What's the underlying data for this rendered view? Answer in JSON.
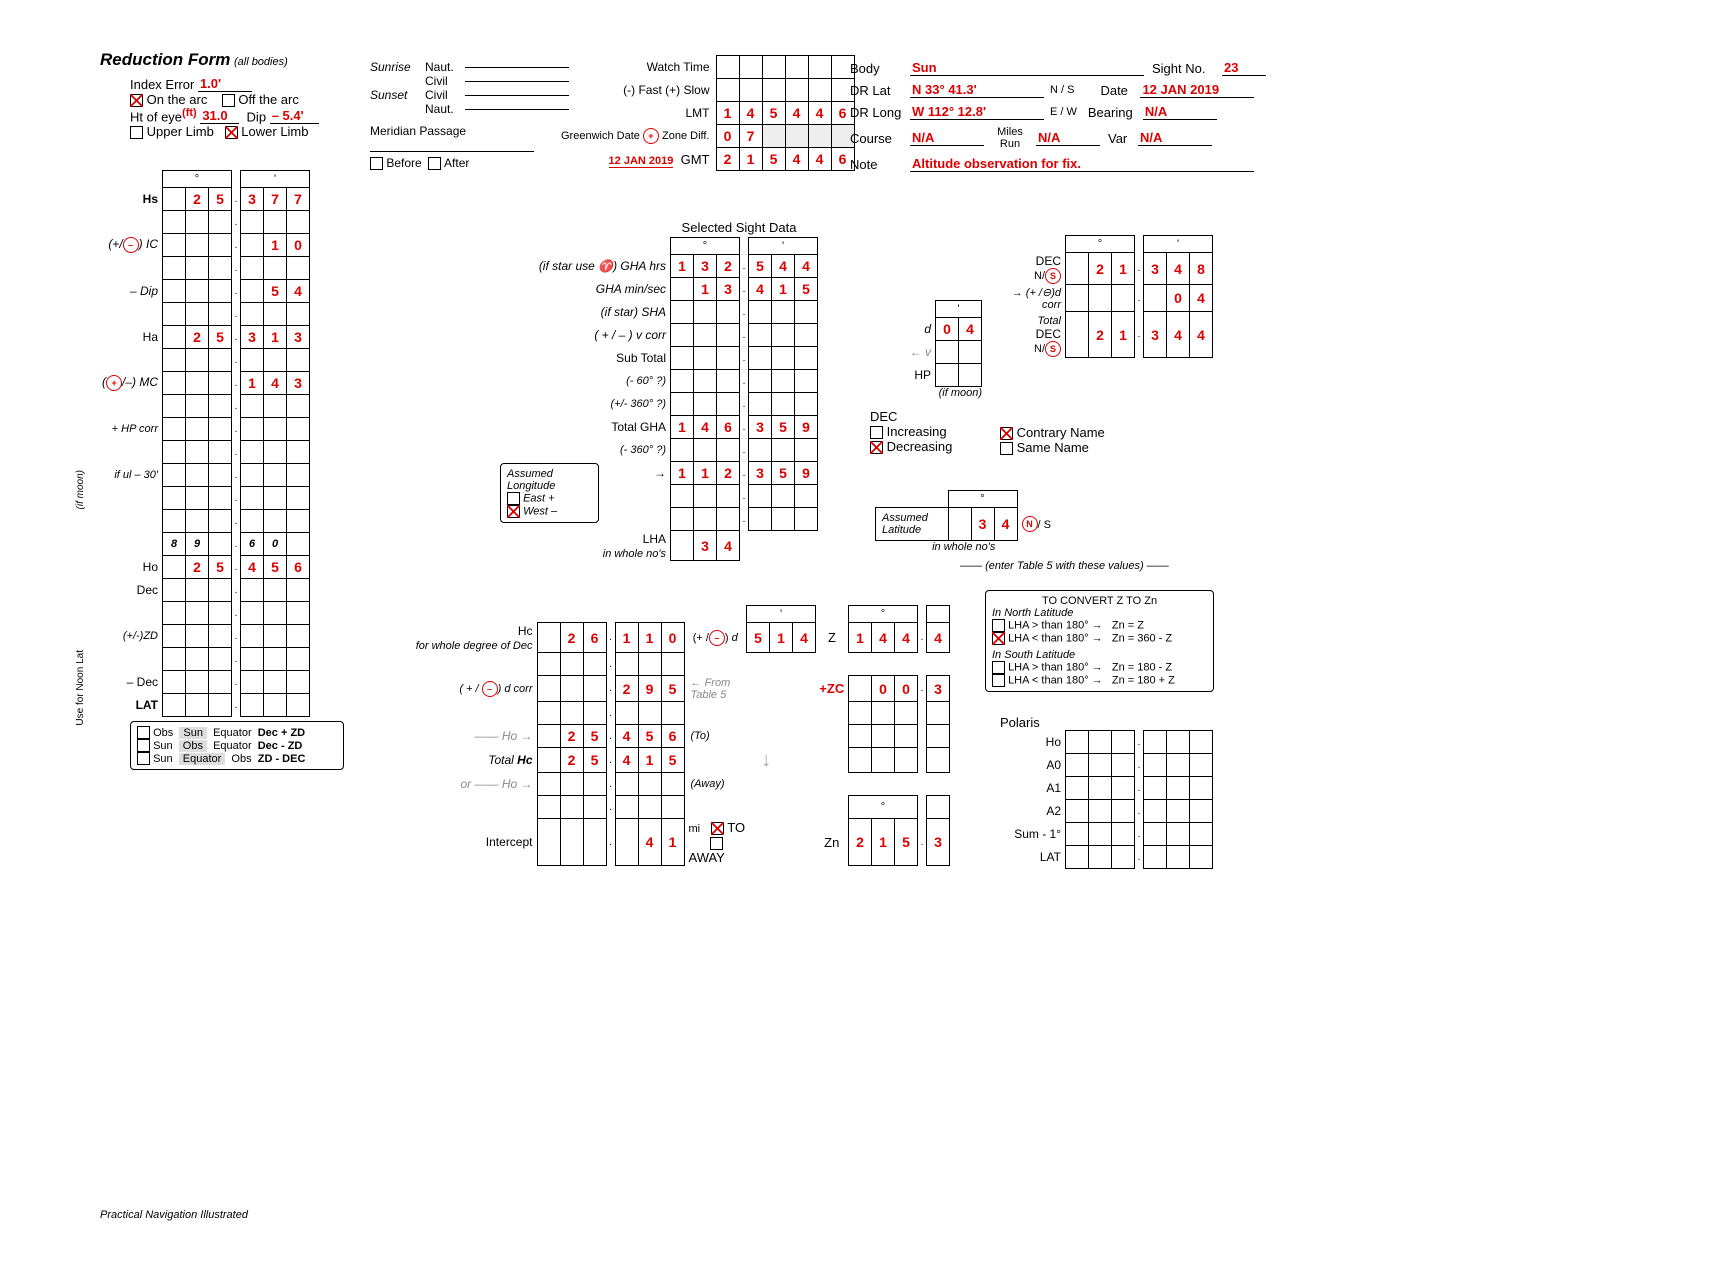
{
  "title": "Reduction Form",
  "subtitle": "(all bodies)",
  "index_error_label": "Index Error",
  "index_error_value": "1.0'",
  "on_arc": "On the arc",
  "off_arc": "Off the arc",
  "ht_eye_label": "Ht of eye",
  "ht_eye_unit": "(ft)",
  "ht_eye_value": "31.0",
  "dip_label": "Dip",
  "dip_value": "– 5.4'",
  "upper_limb": "Upper Limb",
  "lower_limb": "Lower Limb",
  "hs_label": "Hs",
  "hs_deg": [
    "",
    "2",
    "5"
  ],
  "hs_min": [
    "3",
    "7",
    "7"
  ],
  "ic_label": "(+/⊖) IC",
  "ic_min": [
    "",
    "1",
    "0"
  ],
  "dip_row_label": "– Dip",
  "dip_min": [
    "",
    "5",
    "4"
  ],
  "ha_label": "Ha",
  "ha_deg": [
    "",
    "2",
    "5"
  ],
  "ha_min": [
    "3",
    "1",
    "3"
  ],
  "mc_label": "(⊕/–) MC",
  "mc_min": [
    "1",
    "4",
    "3"
  ],
  "hp_corr_label": "+ HP corr",
  "if_ul_label": "if ul – 30'",
  "ho_pre": [
    "8",
    "9",
    "",
    "6",
    "0",
    ""
  ],
  "ho_label": "Ho",
  "ho_deg": [
    "",
    "2",
    "5"
  ],
  "ho_min": [
    "4",
    "5",
    "6"
  ],
  "dec_row": "Dec",
  "zd_row": "(+/-)ZD",
  "minus_dec": "– Dec",
  "lat_row": "LAT",
  "noon_notes": {
    "a": "Obs",
    "b": "Sun",
    "c": "Equator",
    "d": "Dec + ZD",
    "e": "Sun",
    "f": "Obs",
    "g": "Equator",
    "h": "Dec - ZD",
    "i": "Sun",
    "j": "Equator",
    "k": "Obs",
    "l": "ZD - DEC"
  },
  "sunrise": "Sunrise",
  "sunset": "Sunset",
  "naut": "Naut.",
  "civil": "Civil",
  "meridian_passage": "Meridian Passage",
  "before": "Before",
  "after": "After",
  "watch_time": "Watch Time",
  "fast_slow": "(-) Fast (+) Slow",
  "lmt": "LMT",
  "lmt_val": [
    "1",
    "4",
    "5",
    "4",
    "4",
    "6"
  ],
  "greenwich": "Greenwich Date",
  "zone_diff": "Zone Diff.",
  "zone_val": [
    "0",
    "7"
  ],
  "greenwich_date": "12 JAN 2019",
  "gmt": "GMT",
  "gmt_val": [
    "2",
    "1",
    "5",
    "4",
    "4",
    "6"
  ],
  "body_label": "Body",
  "body": "Sun",
  "sight_no_label": "Sight No.",
  "sight_no": "23",
  "drlat_label": "DR Lat",
  "drlat": "N 33° 41.3'",
  "ns": "N / S",
  "date_label": "Date",
  "date": "12 JAN 2019",
  "drlong_label": "DR Long",
  "drlong": "W 112° 12.8'",
  "ew": "E / W",
  "bearing_label": "Bearing",
  "bearing": "N/A",
  "course_label": "Course",
  "course": "N/A",
  "miles_run": "Miles Run",
  "miles": "N/A",
  "var_label": "Var",
  "var": "N/A",
  "note_label": "Note",
  "note": "Altitude observation for fix.",
  "sel_sight": "Selected Sight Data",
  "gha_hrs_label": "(if star use ♈) GHA hrs",
  "gha_hrs_deg": [
    "1",
    "3",
    "2"
  ],
  "gha_hrs_min": [
    "5",
    "4",
    "4"
  ],
  "gha_ms_label": "GHA min/sec",
  "gha_ms_deg": [
    "",
    "1",
    "3"
  ],
  "gha_ms_min": [
    "4",
    "1",
    "5"
  ],
  "sha_label": "(if star) SHA",
  "vcorr_label": "( + / – ) v corr",
  "subtotal_label": "Sub Total",
  "minus60": "(- 60° ?)",
  "pm360": "(+/- 360° ?)",
  "total_gha_label": "Total GHA",
  "total_gha_deg": [
    "1",
    "4",
    "6"
  ],
  "total_gha_min": [
    "3",
    "5",
    "9"
  ],
  "minus360b": "(- 360° ?)",
  "assumed_long": "Assumed Longitude",
  "east": "East +",
  "west": "West –",
  "along_deg": [
    "1",
    "1",
    "2"
  ],
  "along_min": [
    "3",
    "5",
    "9"
  ],
  "lha_label": "LHA",
  "lha_sub": "in whole no's",
  "lha_val": [
    "",
    "3",
    "4"
  ],
  "dec_label": "DEC",
  "dec_ns": "N/S",
  "dec_deg": [
    "",
    "2",
    "1"
  ],
  "dec_min": [
    "3",
    "4",
    "8"
  ],
  "d_label": "d",
  "d_val": [
    "0",
    "4"
  ],
  "d_corr_label": "d corr",
  "d_corr_sign": "(+ /⊖)",
  "d_corr_val": [
    "0",
    "4"
  ],
  "v_label": "v",
  "hp_label": "HP",
  "if_moon": "(if moon)",
  "total_dec_label": "Total DEC",
  "total_dec_deg": [
    "",
    "2",
    "1"
  ],
  "total_dec_min": [
    "3",
    "4",
    "4"
  ],
  "dec_heading": "DEC",
  "increasing": "Increasing",
  "decreasing": "Decreasing",
  "contrary": "Contrary Name",
  "same": "Same Name",
  "assumed_lat_label": "Assumed Latitude",
  "assumed_lat_val": [
    "",
    "3",
    "4"
  ],
  "assumed_lat_ns": "N / S",
  "in_whole": "in whole no's",
  "enter_t5": "(enter Table 5 with these values)",
  "hc_label": "Hc",
  "hc_sub": "for whole degree of Dec",
  "hc_deg": [
    "",
    "2",
    "6"
  ],
  "hc_min": [
    "1",
    "1",
    "0"
  ],
  "hc_d_sign": "(+ /⊖) d",
  "hc_d_val": [
    "5",
    "1",
    "4"
  ],
  "z_label": "Z",
  "z_deg": [
    "1",
    "4",
    "4"
  ],
  "z_min": [
    "4"
  ],
  "dcorr2_label": "( + / ⊖) d corr",
  "dcorr2_min": [
    "2",
    "9",
    "5"
  ],
  "from_t5": "From Table 5",
  "zc_label": "+ZC",
  "zc_deg": [
    "",
    "0",
    "0"
  ],
  "zc_min": [
    "3"
  ],
  "ho_arrow": "Ho",
  "ho2_deg": [
    "",
    "2",
    "5"
  ],
  "ho2_min": [
    "4",
    "5",
    "6"
  ],
  "to": "(To)",
  "total_hc_label": "Total Hc",
  "thc_deg": [
    "",
    "2",
    "5"
  ],
  "thc_min": [
    "4",
    "1",
    "5"
  ],
  "or": "or",
  "away": "(Away)",
  "intercept_label": "Intercept",
  "intercept_val": [
    "",
    "4",
    "1"
  ],
  "mi": "mi",
  "to_cb": "TO",
  "away_cb": "AWAY",
  "zn_label": "Zn",
  "zn_deg": [
    "2",
    "1",
    "5"
  ],
  "zn_min": [
    "3"
  ],
  "convert_title": "TO CONVERT Z TO Zn",
  "north_lat": "In North Latitude",
  "south_lat": "In South Latitude",
  "lha_gt": "LHA > than 180°",
  "lha_lt": "LHA < than 180°",
  "zn_z": "Zn = Z",
  "zn_360": "Zn = 360 - Z",
  "zn_180m": "Zn = 180 - Z",
  "zn_180p": "Zn = 180 + Z",
  "polaris": "Polaris",
  "p_ho": "Ho",
  "p_a0": "A0",
  "p_a1": "A1",
  "p_a2": "A2",
  "p_sum": "Sum - 1°",
  "p_lat": "LAT",
  "footer": "Practical Navigation Illustrated",
  "side_label": "Use for Noon Lat",
  "side_label2": "(if moon)",
  "plus_sign": "⊕"
}
